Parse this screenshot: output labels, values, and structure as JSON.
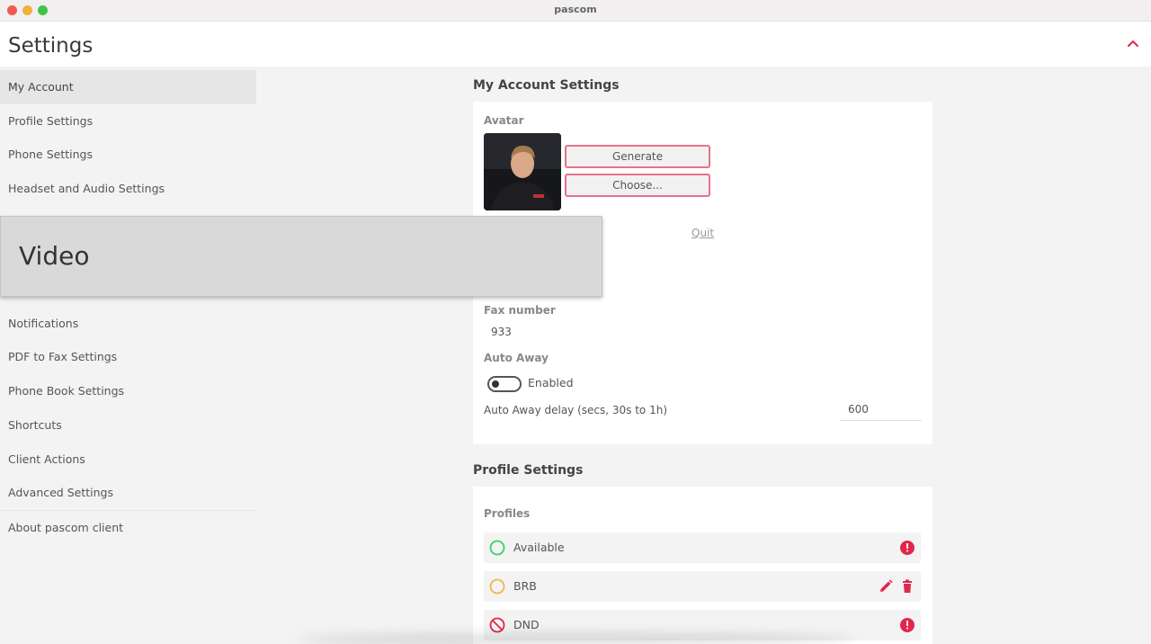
{
  "window": {
    "title": "pascom"
  },
  "header": {
    "title": "Settings"
  },
  "sidebar": {
    "items": [
      {
        "label": "My Account"
      },
      {
        "label": "Profile Settings"
      },
      {
        "label": "Phone Settings"
      },
      {
        "label": "Headset and Audio Settings"
      },
      {
        "label": "Notifications"
      },
      {
        "label": "PDF to Fax Settings"
      },
      {
        "label": "Phone Book Settings"
      },
      {
        "label": "Shortcuts"
      },
      {
        "label": "Client Actions"
      },
      {
        "label": "Advanced Settings"
      },
      {
        "label": "About pascom client"
      }
    ]
  },
  "overlay": {
    "label": "Video"
  },
  "account": {
    "section_title": "My Account Settings",
    "avatar_label": "Avatar",
    "generate_label": "Generate",
    "choose_label": "Choose...",
    "quit_label": "Quit",
    "fax_label": "Fax number",
    "fax_value": "933",
    "auto_away_label": "Auto Away",
    "auto_away_toggle_label": "Enabled",
    "auto_away_enabled": false,
    "delay_label": "Auto Away delay (secs, 30s to 1h)",
    "delay_value": "600"
  },
  "profiles": {
    "section_title": "Profile Settings",
    "label": "Profiles",
    "items": [
      {
        "name": "Available",
        "status_color": "#3ecf6a",
        "icon": "circle-outline-icon",
        "actions": [
          "info-icon"
        ]
      },
      {
        "name": "BRB",
        "status_color": "#f0b64a",
        "icon": "circle-outline-icon",
        "actions": [
          "edit-icon",
          "delete-icon"
        ]
      },
      {
        "name": "DND",
        "status_color": "#e2264d",
        "icon": "no-entry-icon",
        "actions": [
          "info-icon"
        ]
      }
    ]
  },
  "colors": {
    "accent": "#e2264d",
    "button_border": "#e7718a"
  }
}
